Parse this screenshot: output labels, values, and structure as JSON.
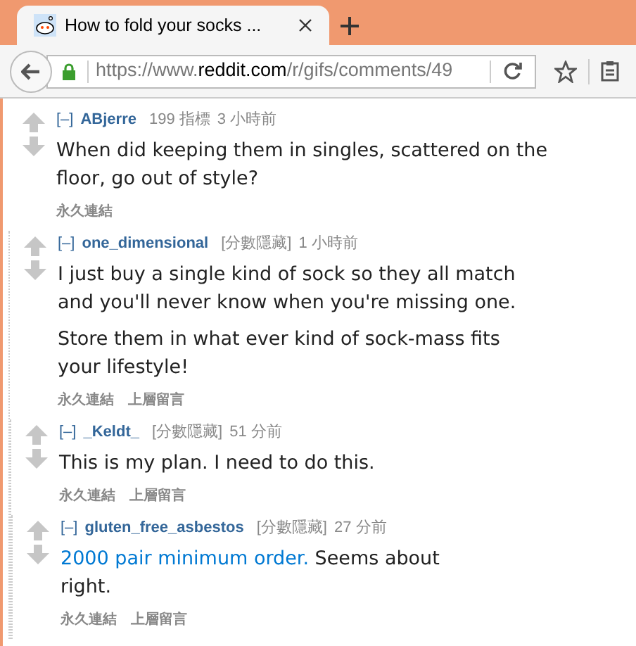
{
  "tab": {
    "title": "How to fold your socks ...",
    "selected": true
  },
  "address_bar": {
    "scheme": "https://www.",
    "domain": "reddit.com",
    "path": "/r/gifs/comments/49"
  },
  "comments": [
    {
      "toggle": "[–]",
      "author": "ABjerre",
      "score": "199 指標",
      "time": "3 小時前",
      "paragraphs": [
        {
          "text": "When did keeping them in singles, scattered on the floor, go out of style?"
        }
      ],
      "actions": [
        "永久連結"
      ],
      "children": [
        {
          "toggle": "[–]",
          "author": "one_dimensional",
          "score": "[分數隱藏]",
          "time": "1 小時前",
          "paragraphs": [
            {
              "text": "I just buy a single kind of sock so they all match and you'll never know when you're missing one."
            },
            {
              "text": "Store them in what ever kind of sock-mass fits your lifestyle!"
            }
          ],
          "actions": [
            "永久連結",
            "上層留言"
          ],
          "children": [
            {
              "toggle": "[–]",
              "author": "_Keldt_",
              "score": "[分數隱藏]",
              "time": "51 分前",
              "paragraphs": [
                {
                  "text": "This is my plan. I need to do this."
                }
              ],
              "actions": [
                "永久連結",
                "上層留言"
              ],
              "children": [
                {
                  "toggle": "[–]",
                  "author": "gluten_free_asbestos",
                  "score": "[分數隱藏]",
                  "time": "27 分前",
                  "paragraphs": [
                    {
                      "link": "2000 pair minimum order.",
                      "text": " Seems about right."
                    }
                  ],
                  "actions": [
                    "永久連結",
                    "上層留言"
                  ]
                }
              ]
            }
          ]
        }
      ]
    }
  ]
}
